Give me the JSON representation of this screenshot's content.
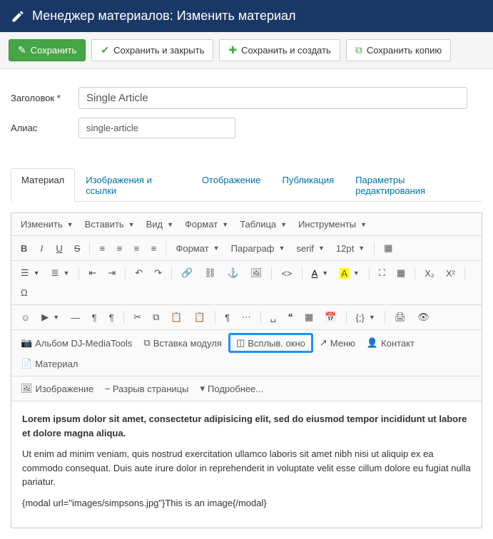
{
  "header": {
    "title": "Менеджер материалов: Изменить материал"
  },
  "toolbar": {
    "save": "Сохранить",
    "save_close": "Сохранить и закрыть",
    "save_new": "Сохранить и создать",
    "save_copy": "Сохранить копию"
  },
  "form": {
    "title_label": "Заголовок *",
    "title_value": "Single Article",
    "alias_label": "Алиас",
    "alias_value": "single-article"
  },
  "tabs": {
    "material": "Материал",
    "images": "Изображения и ссылки",
    "display": "Отображение",
    "publish": "Публикация",
    "params": "Параметры редактирования"
  },
  "editor": {
    "menu": {
      "edit": "Изменить",
      "insert": "Вставить",
      "view": "Вид",
      "format": "Формат",
      "table": "Таблица",
      "tools": "Инструменты"
    },
    "dd": {
      "format": "Формат",
      "paragraph": "Параграф",
      "font": "serif",
      "size": "12pt"
    },
    "btn": {
      "album": "Альбом DJ-MediaTools",
      "module": "Вставка модуля",
      "popup": "Всплыв. окно",
      "menu": "Меню",
      "contact": "Контакт",
      "material": "Материал",
      "image": "Изображение",
      "pagebreak": "Разрыв страницы",
      "readmore": "Подробнее..."
    }
  },
  "content": {
    "p1": "Lorem ipsum dolor sit amet, consectetur adipisicing elit, sed do eiusmod tempor incididunt ut labore et dolore magna aliqua.",
    "p2": "Ut enim ad minim veniam, quis nostrud exercitation ullamco laboris sit amet nibh nisi ut aliquip ex ea commodo consequat. Duis aute irure dolor in reprehenderit in voluptate velit esse cillum dolore eu fugiat nulla pariatur.",
    "p3": "{modal url=\"images/simpsons.jpg\"}This is an image{/modal}"
  }
}
